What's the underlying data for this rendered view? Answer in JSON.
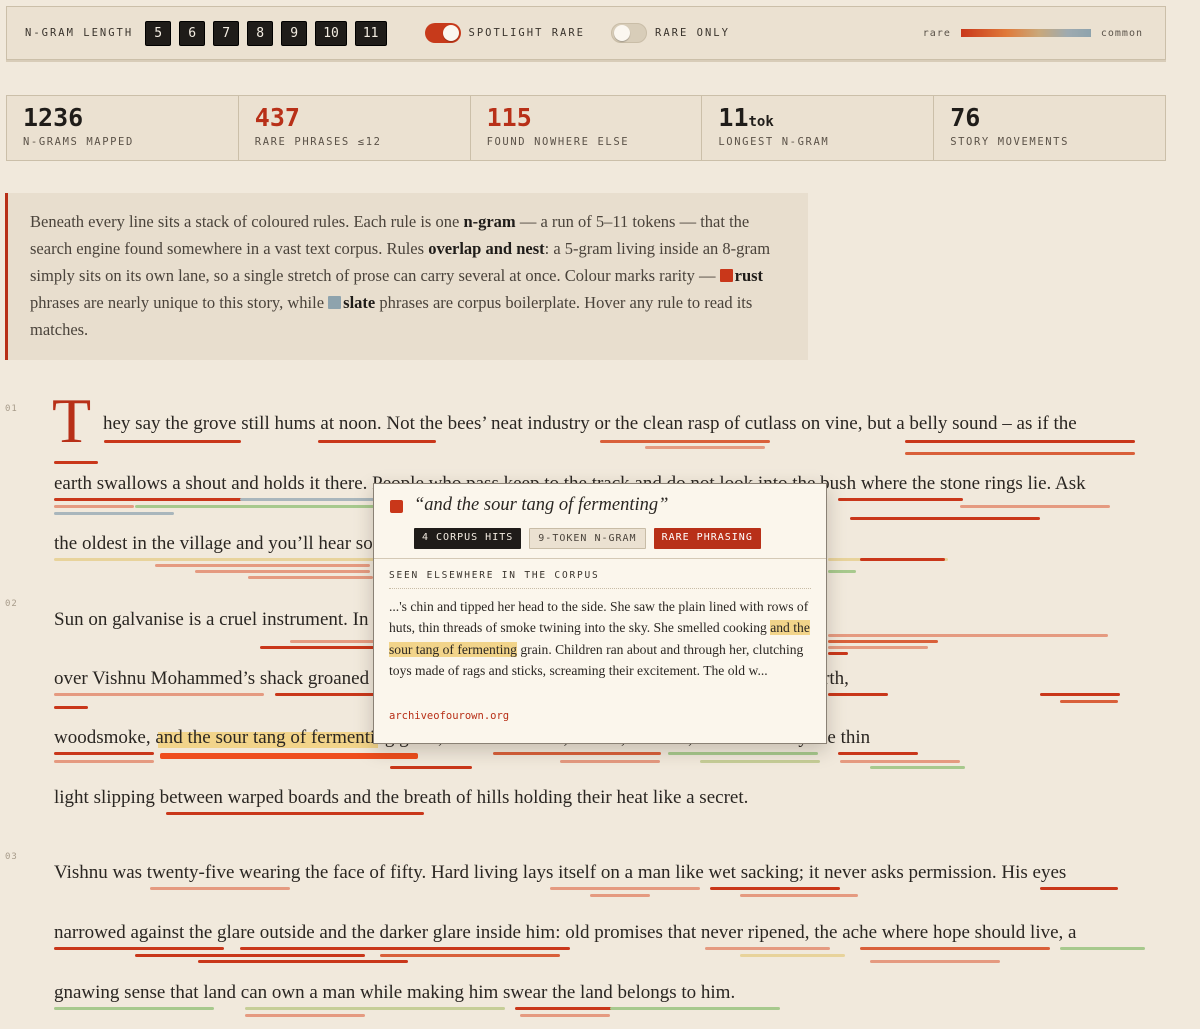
{
  "toolbar": {
    "ngram_length_label": "N-GRAM LENGTH",
    "lengths": [
      "5",
      "6",
      "7",
      "8",
      "9",
      "10",
      "11"
    ],
    "spotlight_label": "SPOTLIGHT RARE",
    "spotlight_on": true,
    "rare_only_label": "RARE ONLY",
    "rare_only_on": false,
    "legend_rare": "rare",
    "legend_common": "common"
  },
  "colors": {
    "rust": "#c9371a",
    "slate": "#8ea3ad",
    "background": "#f1e9dc",
    "highlight": "#f2d48a"
  },
  "stats": [
    {
      "value": "1236",
      "unit": "",
      "label": "N-GRAMS MAPPED",
      "accent": false
    },
    {
      "value": "437",
      "unit": "",
      "label": "RARE PHRASES ≤12",
      "accent": true
    },
    {
      "value": "115",
      "unit": "",
      "label": "FOUND NOWHERE ELSE",
      "accent": true
    },
    {
      "value": "11",
      "unit": "tok",
      "label": "LONGEST N-GRAM",
      "accent": false
    },
    {
      "value": "76",
      "unit": "",
      "label": "STORY MOVEMENTS",
      "accent": false
    }
  ],
  "intro": {
    "p1": "Beneath every line sits a stack of coloured rules. Each rule is one ",
    "b1": "n-gram",
    "p2": " — a run of 5–11 tokens — that the search engine found somewhere in a vast text corpus. Rules ",
    "b2": "overlap and nest",
    "p3": ": a 5-gram living inside an 8-gram simply sits on its own lane, so a single stretch of prose can carry several at once. Colour marks rarity — ",
    "rust_word": "rust",
    "p4": " phrases are nearly unique to this story, while ",
    "slate_word": "slate",
    "p5": " phrases are corpus boilerplate. Hover any rule to read its matches."
  },
  "story": {
    "dropcap": "T",
    "para_nums": [
      "01",
      "02",
      "03"
    ],
    "lines": [
      "hey say the grove still hums at noon. Not the bees’ neat industry or the clean rasp of cutlass on vine, but a belly sound – as if the",
      "earth swallows a shout and holds it there. People who pass keep to the track and do not look into the bush where the stone rings lie. Ask",
      "the oldest in the village and you’ll hear some version of the same line. The grove ain’t forget.’",
      "Sun on galvanise is a cruel instrument. In the season after the grove began to remember, the roof",
      "over Vishnu Mohammed’s shack groaned under it. The air inside was thick as porridge skin: damp earth,",
      "woodsmoke, and the sour tang of fermenting grain, and no window, no fan, no bulb, no hum – only the thin",
      "light slipping between warped boards and the breath of hills holding their heat like a secret.",
      "Vishnu was twenty-five wearing the face of fifty. Hard living lays itself on a man like wet sacking; it never asks permission. His eyes",
      "narrowed against the glare outside and the darker glare inside him: old promises that never ripened, the ache where hope should live, a",
      "gnawing sense that land can own a man while making him swear the land belongs to him."
    ]
  },
  "tooltip": {
    "quote": "“and the sour tang of fermenting”",
    "badges": [
      "4 CORPUS HITS",
      "9-TOKEN N-GRAM",
      "RARE PHRASING"
    ],
    "heading": "SEEN ELSEWHERE IN THE CORPUS",
    "excerpt_before": "...'s chin and tipped her head to the side. She saw the plain lined with rows of huts, thin threads of smoke twining into the sky. She smelled cooking ",
    "excerpt_match": "and the sour tang of fermenting",
    "excerpt_after": " grain. Children ran about and through her, clutching toys made of rags and sticks, screaming their excitement. The old w...",
    "source": "archiveofourown.org"
  }
}
